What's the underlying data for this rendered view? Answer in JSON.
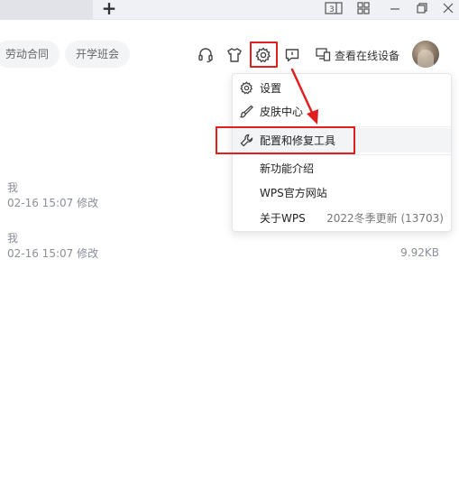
{
  "toolbar": {
    "chips": [
      "劳动合同",
      "开学班会"
    ],
    "devices_label": "查看在线设备"
  },
  "icons": {
    "headset": "headset-icon",
    "skin": "tshirt-icon",
    "settings": "gear-icon",
    "feedback": "chat-bubble-icon",
    "devices": "devices-icon"
  },
  "files": [
    {
      "owner": "我",
      "modified": "02-16 15:07 修改",
      "size": ""
    },
    {
      "owner": "我",
      "modified": "02-16 15:07 修改",
      "size": "9.92KB"
    }
  ],
  "menu": {
    "items": [
      {
        "label": "设置",
        "icon": "gear-icon"
      },
      {
        "label": "皮肤中心",
        "icon": "brush-icon"
      },
      {
        "label": "配置和修复工具",
        "icon": "wrench-icon"
      },
      {
        "label": "新功能介绍",
        "icon": ""
      },
      {
        "label": "WPS官方网站",
        "icon": ""
      },
      {
        "label": "关于WPS",
        "icon": "",
        "extra": "2022冬季更新 (13703)"
      }
    ]
  },
  "colors": {
    "highlight": "#e0201f",
    "menu_hover": "#f3f4f6",
    "meta_text": "#8a8f99"
  }
}
